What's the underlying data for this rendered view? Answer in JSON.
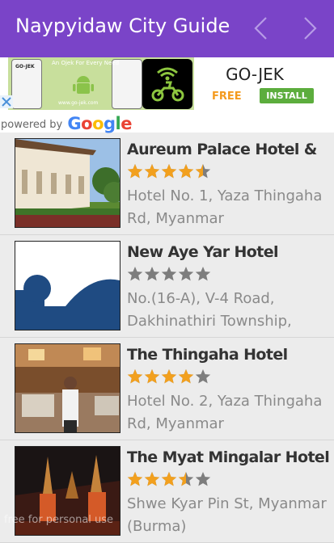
{
  "appbar": {
    "title": "Naypyidaw City Guide",
    "background": "#7a44c8",
    "prev_icon": "chevron-left-icon",
    "next_icon": "chevron-right-icon"
  },
  "ad": {
    "brand": "GO-JEK",
    "free_label": "FREE",
    "install_label": "INSTALL",
    "image_brand": "GO-JEK",
    "image_tagline": "An Ojek For Every Need",
    "image_url": "www.go-jek.com",
    "powered_by": "powered by",
    "google": "Google",
    "close_icon": "close-x-icon"
  },
  "hotels": [
    {
      "name": "Aureum Palace Hotel &",
      "rating": 4.5,
      "address": "Hotel No. 1, Yaza Thingaha Rd, Myanmar"
    },
    {
      "name": "New Aye Yar Hotel",
      "rating": 0,
      "address": "No.(16-A), V-4 Road, Dakhinathiri Township,"
    },
    {
      "name": "The Thingaha Hotel",
      "rating": 4,
      "address": "Hotel No. 2, Yaza Thingaha Rd, Myanmar"
    },
    {
      "name": "The Myat Mingalar Hotel",
      "rating": 3.5,
      "address": "Shwe Kyar Pin St, Myanmar (Burma)"
    }
  ],
  "colors": {
    "star_on": "#f2a01e",
    "star_off": "#7d7d7d"
  },
  "watermark": "free for personal use"
}
